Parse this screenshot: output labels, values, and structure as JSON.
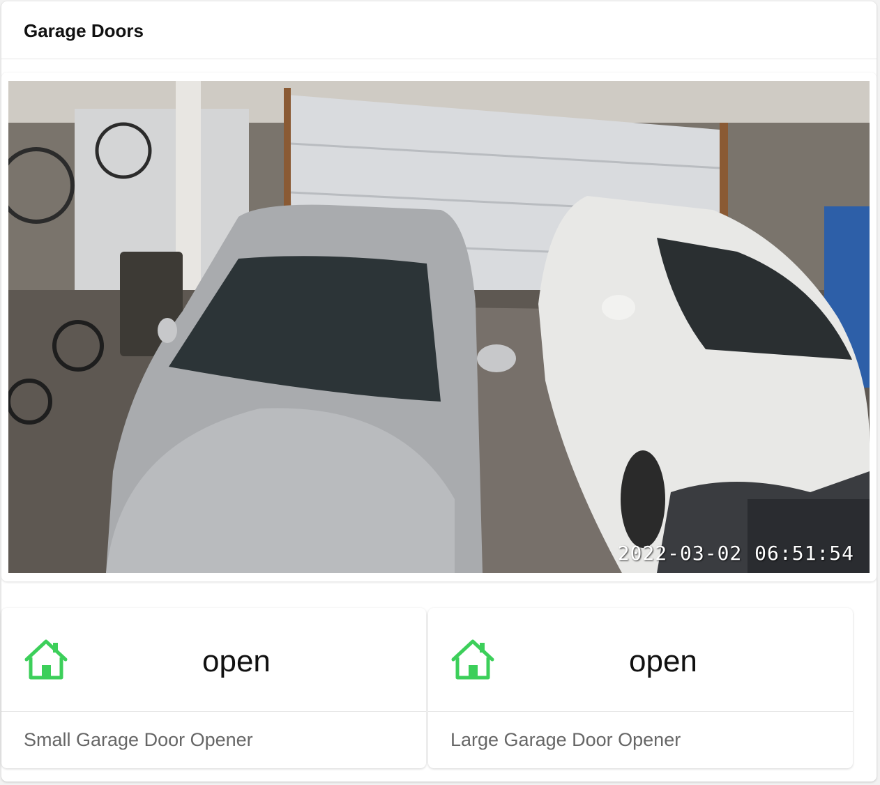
{
  "card": {
    "title": "Garage Doors"
  },
  "camera": {
    "timestamp": "2022-03-02  06:51:54"
  },
  "tiles": [
    {
      "icon": "home-icon",
      "state": "open",
      "name": "Small Garage Door Opener",
      "icon_color": "#3ccf5a"
    },
    {
      "icon": "home-icon",
      "state": "open",
      "name": "Large Garage Door Opener",
      "icon_color": "#3ccf5a"
    }
  ],
  "colors": {
    "accent_open": "#3ccf5a",
    "header_text": "#111111",
    "secondary_text": "#666666"
  }
}
